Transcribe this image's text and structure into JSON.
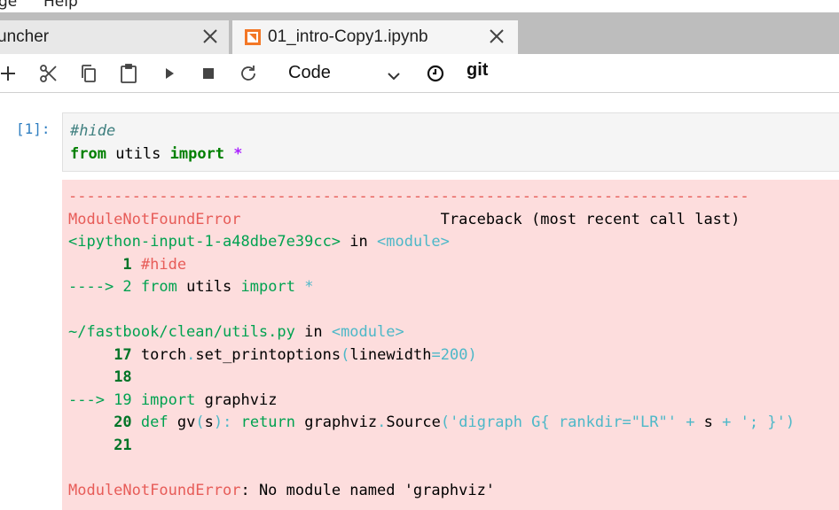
{
  "menu": {
    "items": [
      "ge",
      "Help"
    ]
  },
  "tabs": [
    {
      "label": "uncher",
      "active": false
    },
    {
      "label": "01_intro-Copy1.ipynb",
      "active": true
    }
  ],
  "toolbar": {
    "cell_type": "Code",
    "git_label": "git",
    "icons": [
      "add-icon",
      "cut-icon",
      "copy-icon",
      "paste-icon",
      "run-icon",
      "stop-icon",
      "restart-icon",
      "chevron-down-icon",
      "kernel-status-icon"
    ]
  },
  "cell": {
    "prompt": "[1]:",
    "input": {
      "line1": "#hide",
      "line2_kw1": "from",
      "line2_mod": " utils ",
      "line2_kw2": "import",
      "line2_star": "*"
    },
    "output": {
      "dashes": "---------------------------------------------------------------------------",
      "err_name": "ModuleNotFoundError",
      "traceback_hdr": "Traceback (most recent call last)",
      "input_ref": "<ipython-input-1-a48dbe7e39cc>",
      "in_word": " in ",
      "module": "<module>",
      "l1_num": "1",
      "l1_code": "#hide",
      "l2_arrow": "----> 2",
      "l2_kw1": "from",
      "l2_mod": " utils ",
      "l2_kw2": "import",
      "l2_star": "*",
      "file_path": "~/fastbook/clean/utils.py",
      "l17_num": "17",
      "l17_a": "torch",
      "l17_b": ".",
      "l17_c": "set_printoptions",
      "l17_d": "(",
      "l17_e": "linewidth",
      "l17_f": "=",
      "l17_g": "200",
      "l17_h": ")",
      "l18_num": "18",
      "l19_arrow": "---> 19",
      "l19_kw": "import",
      "l19_mod": " graphviz",
      "l20_num": "20",
      "l20_def": "def",
      "l20_fn": " gv",
      "l20_p1": "(",
      "l20_s": "s",
      "l20_p2": "):",
      "l20_ret": "return",
      "l20_obj": " graphviz",
      "l20_dot": ".",
      "l20_src": "Source",
      "l20_p3": "(",
      "l20_str1": "'digraph G{ rankdir=\"LR\"'",
      "l20_plus1": "+",
      "l20_s2": " s ",
      "l20_plus2": "+",
      "l20_str2": "'; }'",
      "l20_p4": ")",
      "l21_num": "21",
      "final_err": "ModuleNotFoundError",
      "final_msg": ": No module named 'graphviz'"
    }
  }
}
